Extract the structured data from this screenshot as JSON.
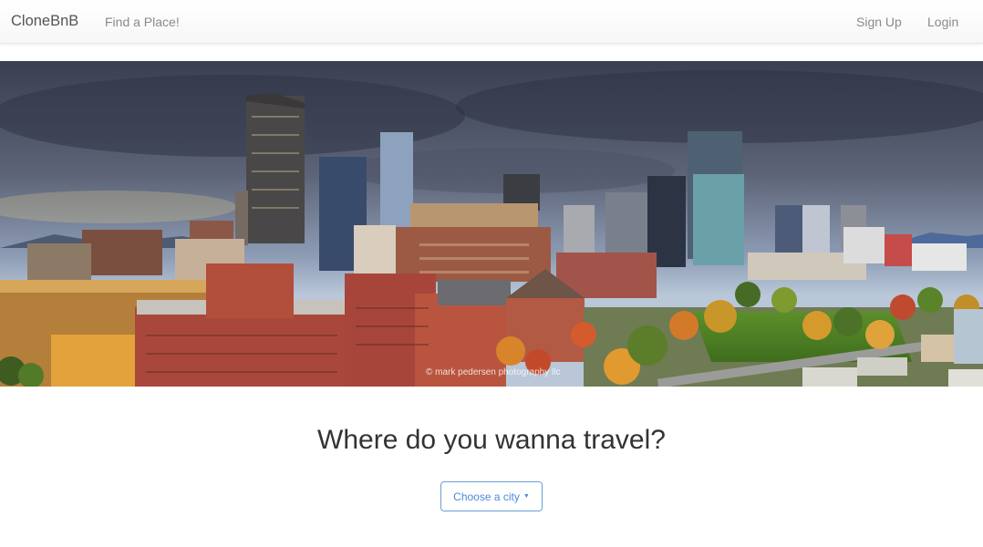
{
  "navbar": {
    "brand": "CloneBnB",
    "find_link": "Find a Place!",
    "signup_link": "Sign Up",
    "login_link": "Login"
  },
  "hero": {
    "credit": "© mark pedersen photography llc"
  },
  "main": {
    "headline": "Where do you wanna travel?",
    "city_button_label": "Choose a city",
    "city_button_icon": "caret-down-icon"
  },
  "colors": {
    "accent": "#4a89dc",
    "navbar_text": "#8a8a8a"
  }
}
